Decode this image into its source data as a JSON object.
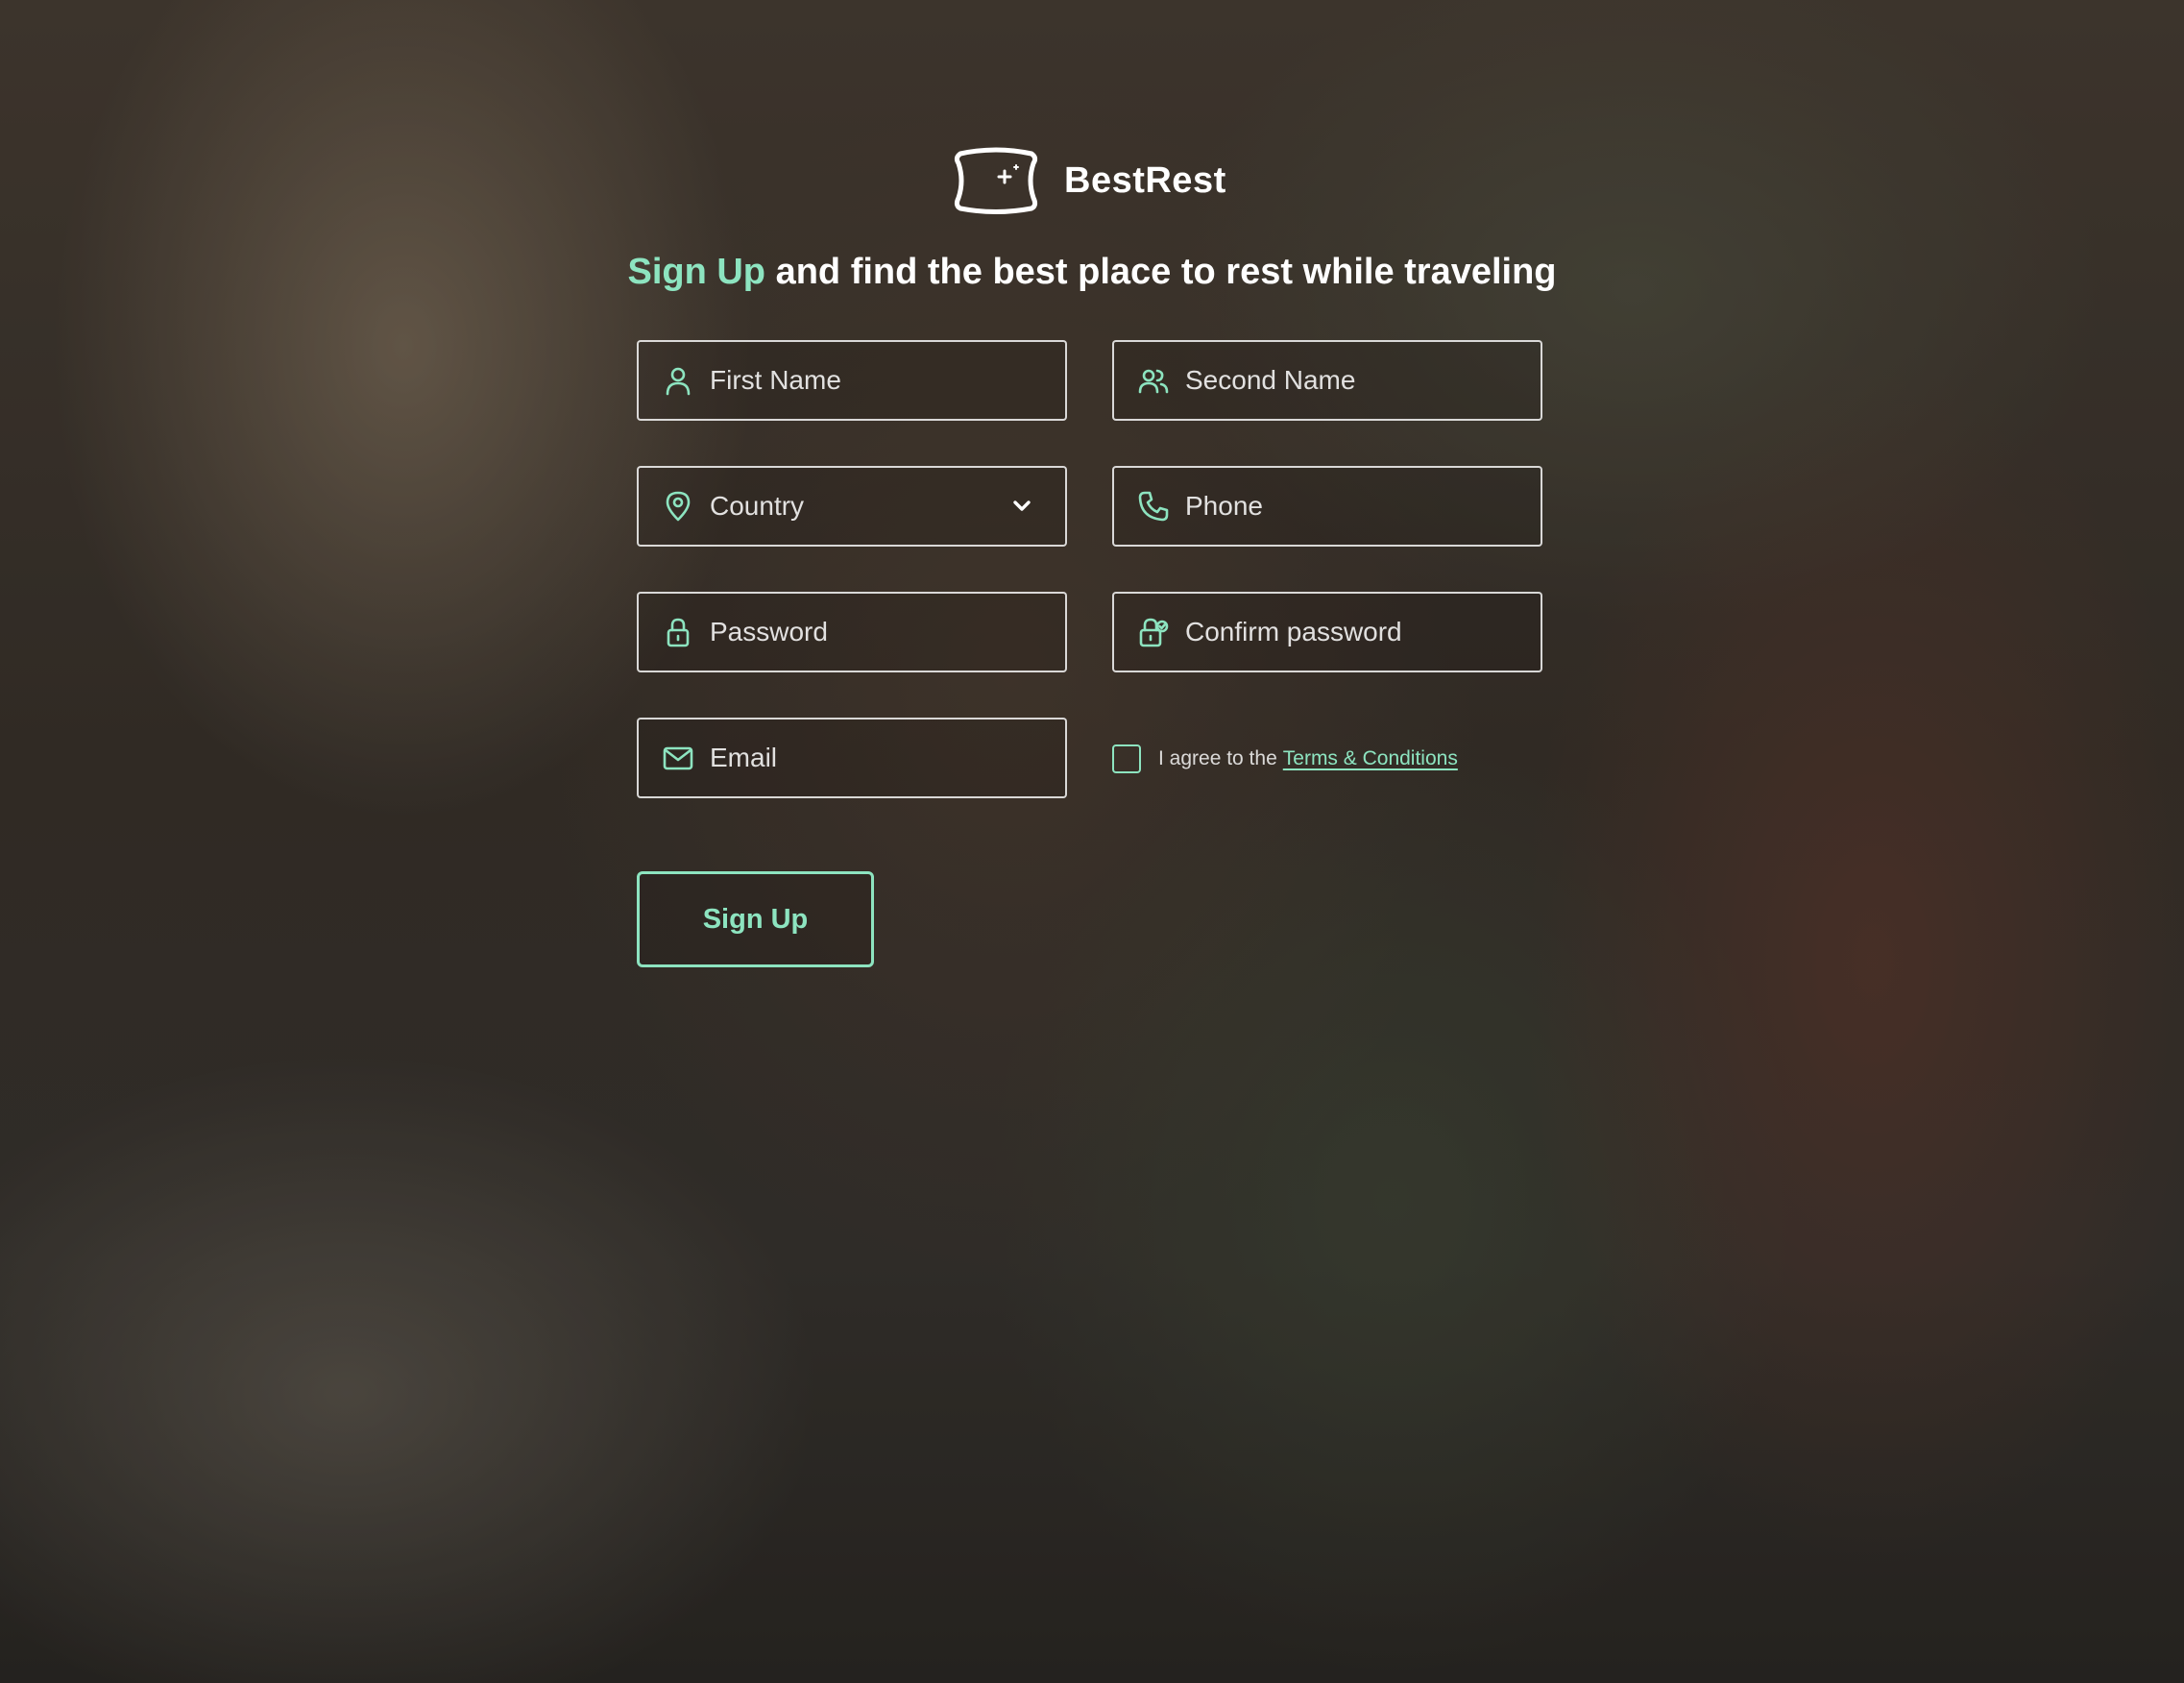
{
  "brand": {
    "name": "BestRest",
    "logo_icon": "pillow-icon"
  },
  "headline": {
    "accent": "Sign Up",
    "rest": "and find the best place to rest while traveling"
  },
  "colors": {
    "accent": "#8de4c0",
    "text": "#ffffff",
    "field_border": "#ffffff"
  },
  "form": {
    "first_name": {
      "placeholder": "First Name",
      "icon": "user-icon"
    },
    "second_name": {
      "placeholder": "Second Name",
      "icon": "users-icon"
    },
    "country": {
      "value": "Country",
      "icon": "location-pin-icon",
      "dropdown_icon": "chevron-down-icon"
    },
    "phone": {
      "placeholder": "Phone",
      "icon": "phone-icon"
    },
    "password": {
      "placeholder": "Password",
      "icon": "lock-icon"
    },
    "confirm_password": {
      "placeholder": "Confirm password",
      "icon": "lock-check-icon"
    },
    "email": {
      "placeholder": "Email",
      "icon": "mail-icon"
    },
    "agree": {
      "checked": false,
      "text": "I agree to the",
      "link": "Terms & Conditions"
    },
    "submit_label": "Sign Up"
  }
}
